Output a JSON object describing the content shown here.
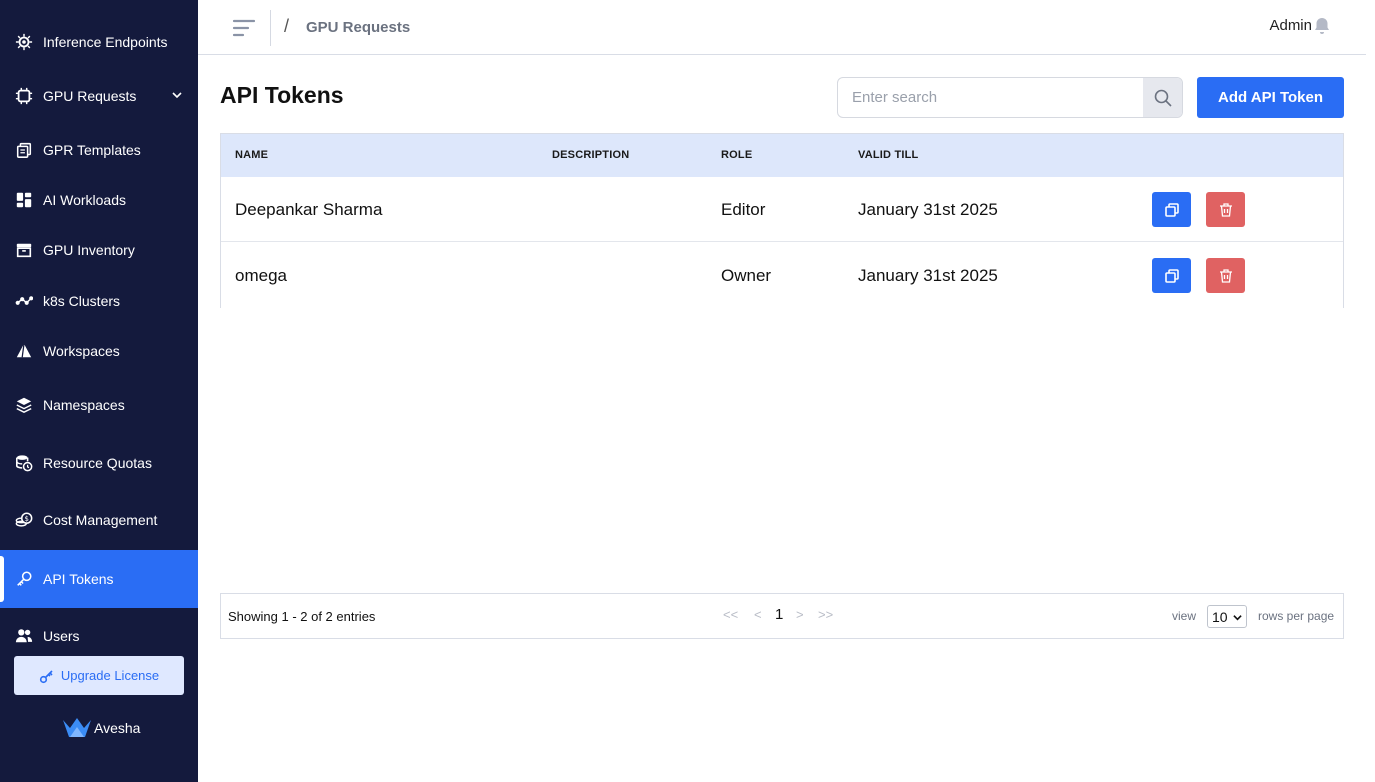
{
  "sidebar": {
    "items": [
      {
        "label": "Inference Endpoints",
        "icon": "chip-gear-icon"
      },
      {
        "label": "GPU Requests",
        "icon": "cpu-icon",
        "expandable": true
      },
      {
        "label": "GPR Templates",
        "icon": "copy-stack-icon"
      },
      {
        "label": "AI Workloads",
        "icon": "dashboard-icon"
      },
      {
        "label": "GPU Inventory",
        "icon": "archive-box-icon"
      },
      {
        "label": "k8s Clusters",
        "icon": "network-nodes-icon"
      },
      {
        "label": "Workspaces",
        "icon": "pyramid-icon"
      },
      {
        "label": "Namespaces",
        "icon": "layers-icon"
      },
      {
        "label": "Resource Quotas",
        "icon": "database-clock-icon"
      },
      {
        "label": "Cost Management",
        "icon": "coins-icon"
      },
      {
        "label": "API Tokens",
        "icon": "key-icon",
        "active": true
      },
      {
        "label": "Users",
        "icon": "users-icon"
      }
    ],
    "upgrade_label": "Upgrade License",
    "brand": "Avesha"
  },
  "header": {
    "breadcrumb_sep": "/",
    "breadcrumb": "GPU Requests",
    "user": "Admin"
  },
  "main": {
    "title": "API Tokens",
    "search_placeholder": "Enter search",
    "add_label": "Add API Token",
    "columns": [
      "NAME",
      "DESCRIPTION",
      "ROLE",
      "VALID TILL"
    ],
    "rows": [
      {
        "name": "Deepankar Sharma",
        "description": "",
        "role": "Editor",
        "valid_till": "January 31st 2025"
      },
      {
        "name": "omega",
        "description": "",
        "role": "Owner",
        "valid_till": "January 31st 2025"
      }
    ]
  },
  "pagination": {
    "showing": "Showing 1 - 2 of 2 entries",
    "first": "<<",
    "prev": "<",
    "current": "1",
    "next": ">",
    "last": ">>",
    "view_label": "view",
    "rows_per_page": "10",
    "rows_per_page_label": "rows per page"
  },
  "colors": {
    "sidebar_bg": "#141a3d",
    "accent": "#2a6df4",
    "danger": "#e06262",
    "table_header_bg": "#dde7fb"
  }
}
